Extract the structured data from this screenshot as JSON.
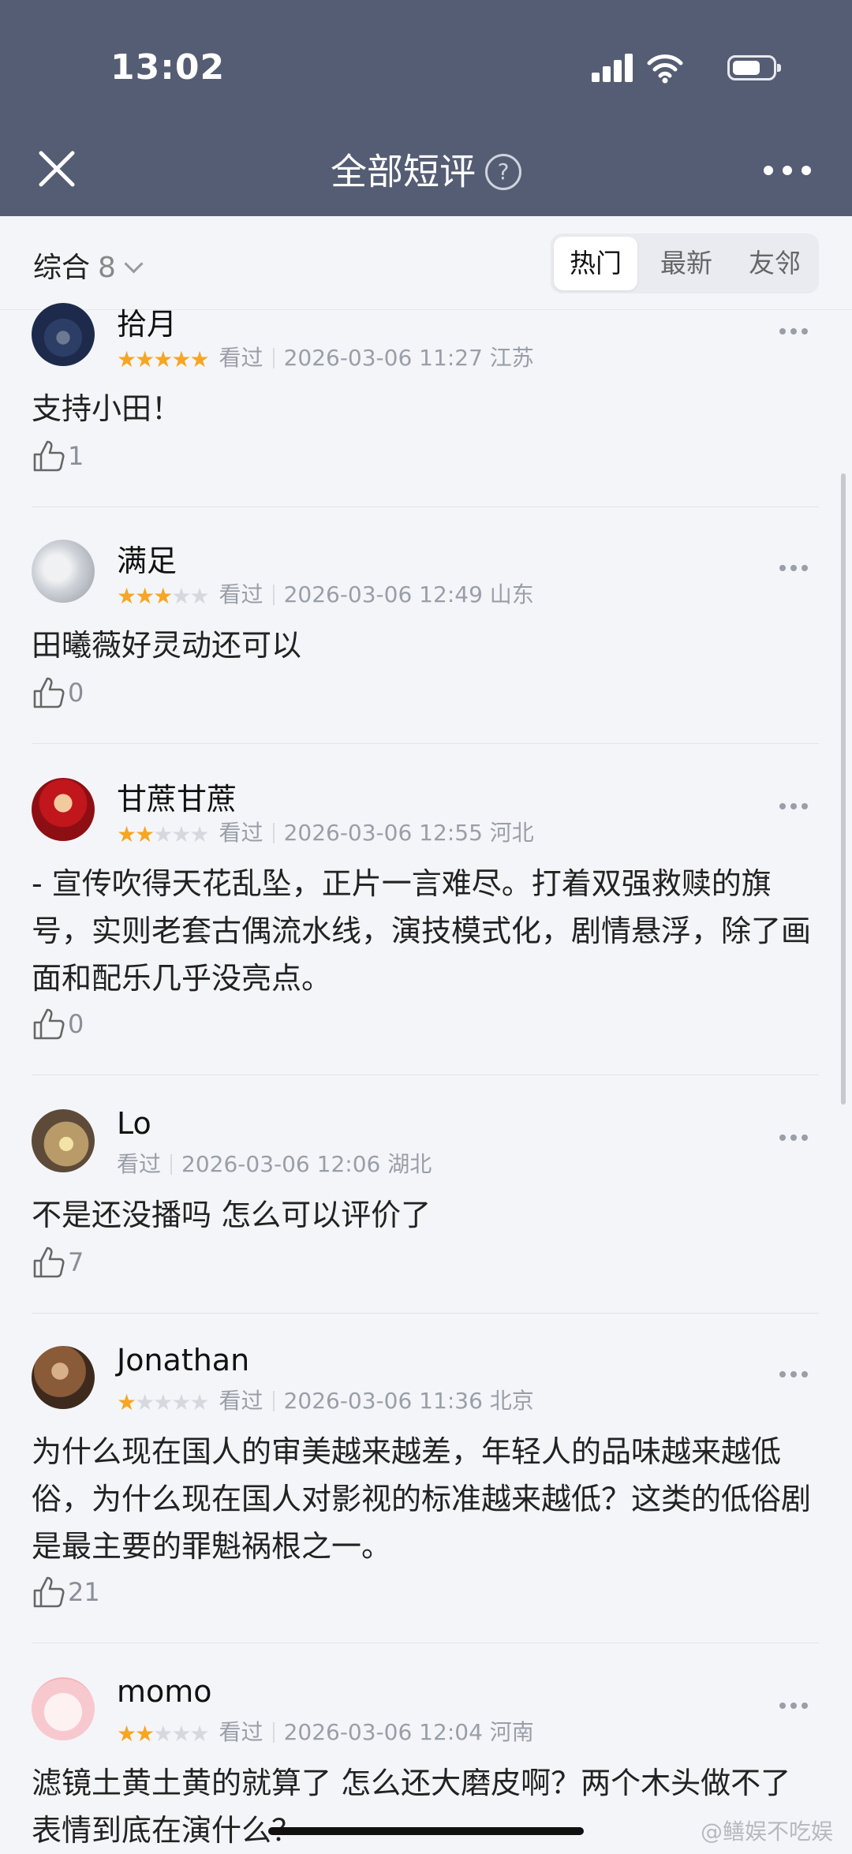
{
  "status": {
    "time": "13:02"
  },
  "nav": {
    "title": "全部短评",
    "help": "?"
  },
  "filter": {
    "sort_label": "综合",
    "sort_count": "8",
    "tabs": [
      {
        "label": "热门",
        "active": true
      },
      {
        "label": "最新",
        "active": false
      },
      {
        "label": "友邻",
        "active": false
      }
    ]
  },
  "reviews": [
    {
      "user": "拾月",
      "stars": 5,
      "watched": "看过",
      "datetime": "2026-03-06 11:27",
      "location": "江苏",
      "text": "支持小田！",
      "likes": "1"
    },
    {
      "user": "满足",
      "stars": 3,
      "watched": "看过",
      "datetime": "2026-03-06 12:49",
      "location": "山东",
      "text": "田曦薇好灵动还可以",
      "likes": "0"
    },
    {
      "user": "甘蔗甘蔗",
      "stars": 2,
      "watched": "看过",
      "datetime": "2026-03-06 12:55",
      "location": "河北",
      "text": "- 宣传吹得天花乱坠，正片一言难尽。打着双强救赎的旗号，实则老套古偶流水线，演技模式化，剧情悬浮，除了画面和配乐几乎没亮点。",
      "likes": "0"
    },
    {
      "user": "Lo",
      "stars": 0,
      "watched": "看过",
      "datetime": "2026-03-06 12:06",
      "location": "湖北",
      "text": "不是还没播吗 怎么可以评价了",
      "likes": "7"
    },
    {
      "user": "Jonathan",
      "stars": 1,
      "watched": "看过",
      "datetime": "2026-03-06 11:36",
      "location": "北京",
      "text": "为什么现在国人的审美越来越差，年轻人的品味越来越低俗，为什么现在国人对影视的标准越来越低？这类的低俗剧是最主要的罪魁祸根之一。",
      "likes": "21"
    },
    {
      "user": "momo",
      "stars": 2,
      "watched": "看过",
      "datetime": "2026-03-06 12:04",
      "location": "河南",
      "text": "滤镜土黄土黄的就算了 怎么还大磨皮啊？两个木头做不了表情到底在演什么？",
      "likes": ""
    }
  ],
  "watermark": "@鳝娱不吃娱",
  "colors": {
    "header": "#555d74",
    "star_on": "#f6a623",
    "star_off": "#d6d8de",
    "background": "#f4f5f8"
  }
}
